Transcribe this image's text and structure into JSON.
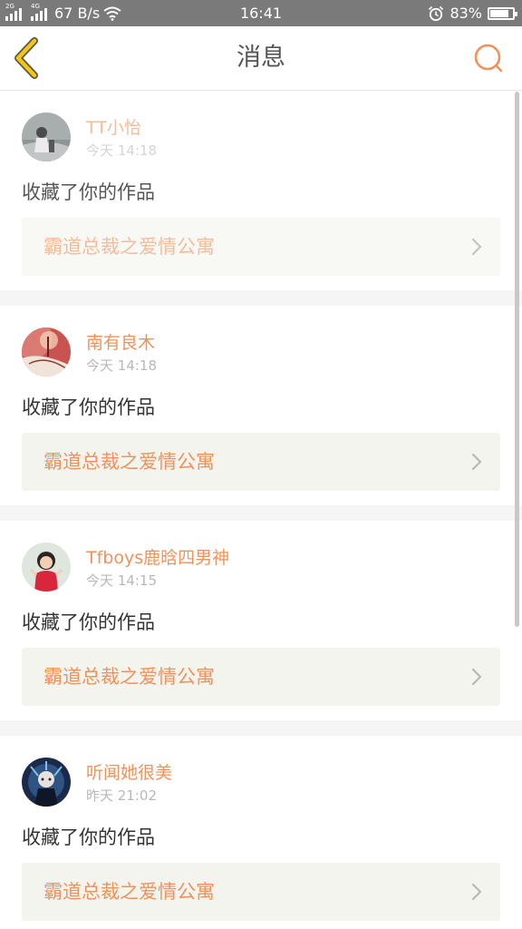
{
  "status_bar": {
    "network1": "2G",
    "network2": "4G",
    "speed": "67 B/s",
    "time": "16:41",
    "battery": "83%",
    "battery_level": 0.83
  },
  "header": {
    "title": "消息",
    "back_icon": "chevron-left-icon",
    "search_icon": "search-icon"
  },
  "colors": {
    "accent": "#f0925b",
    "back_icon": "#f5c518"
  },
  "messages": [
    {
      "user": "TT小怡",
      "time": "今天 14:18",
      "action": "收藏了你的作品",
      "work": "霸道总裁之爱情公寓"
    },
    {
      "user": "南有良木",
      "time": "今天 14:18",
      "action": "收藏了你的作品",
      "work": "霸道总裁之爱情公寓"
    },
    {
      "user": "Tfboys鹿晗四男神",
      "time": "今天 14:15",
      "action": "收藏了你的作品",
      "work": "霸道总裁之爱情公寓"
    },
    {
      "user": "听闻她很美",
      "time": "昨天 21:02",
      "action": "收藏了你的作品",
      "work": "霸道总裁之爱情公寓"
    }
  ]
}
